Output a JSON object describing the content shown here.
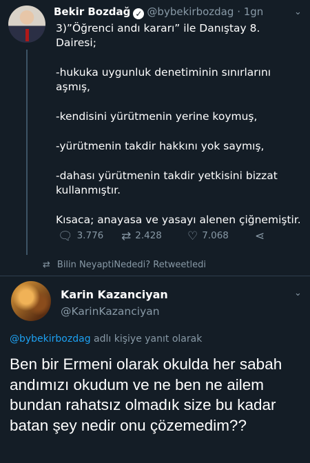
{
  "tweet": {
    "author_name": "Bekir Bozdağ",
    "author_handle": "@bybekirbozdag",
    "time": "· 1gn",
    "lines": [
      "3)”Öğrenci andı kararı” ile Danıştay 8. Dairesi;",
      "-hukuka uygunluk denetiminin sınırlarını aşmış,",
      "-kendisini yürütmenin yerine koymuş,",
      "-yürütmenin takdir hakkını yok saymış,",
      "-dahası yürütmenin takdir yetkisini bizzat kullanmıştır.",
      "Kısaca; anayasa ve yasayı alenen çiğnemiştir."
    ],
    "actions": {
      "reply_count": "3.776",
      "retweet_count": "2.428",
      "like_count": "7.068"
    }
  },
  "retweet_note": "Bilin NeyaptiNededi? Retweetledi",
  "reply": {
    "author_name": "Karin Kazanciyan",
    "author_handle": "@KarinKazanciyan",
    "reply_to_mention": "@bybekirbozdag",
    "reply_to_suffix": " adlı kişiye yanıt olarak",
    "text": "Ben bir Ermeni olarak okulda her sabah andımızı okudum ve ne ben ne ailem bundan rahatsız olmadık size bu kadar batan şey nedir onu çözemedim??"
  },
  "icons": {
    "verified": "verified-badge-icon",
    "reply": "reply-icon",
    "retweet": "retweet-icon",
    "like": "heart-icon",
    "share": "share-icon",
    "chevron": "chevron-down-icon"
  },
  "colors": {
    "background": "#141d26",
    "muted": "#8899a6",
    "link": "#1da1f2"
  }
}
